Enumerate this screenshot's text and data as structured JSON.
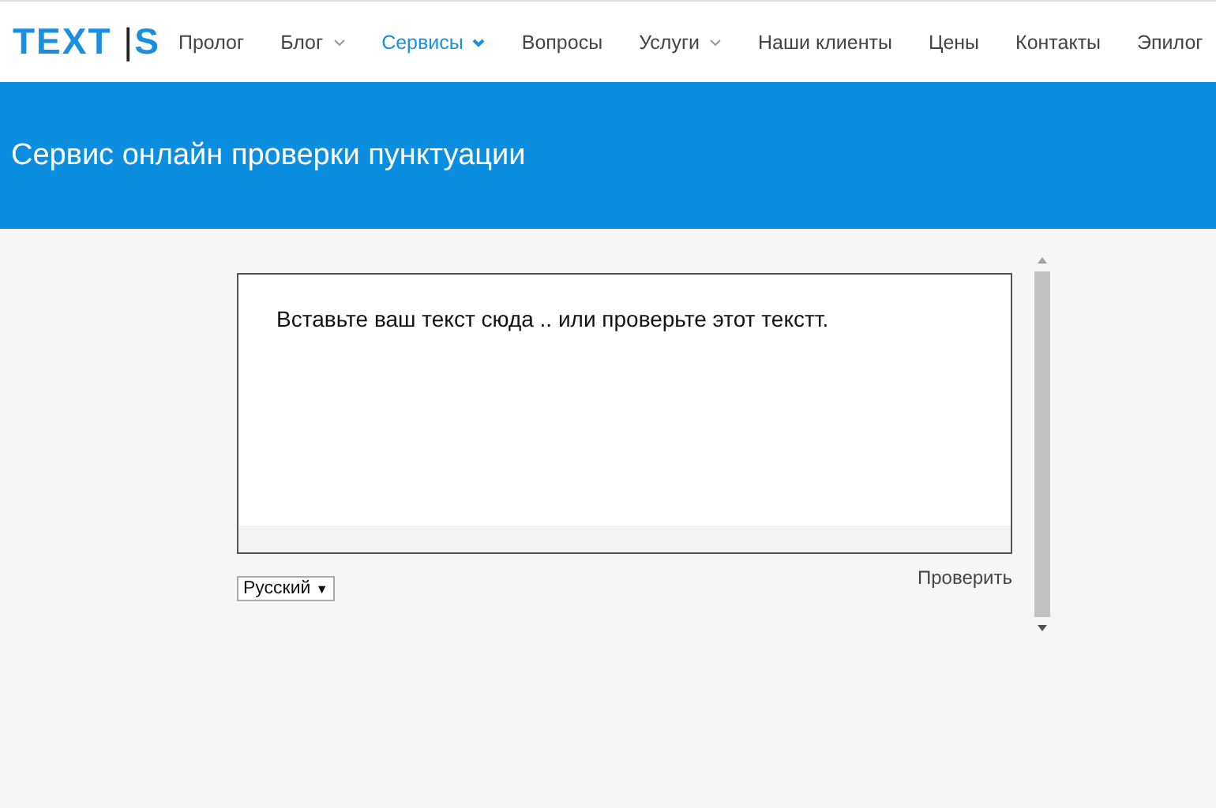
{
  "logo": {
    "text": "TEXT",
    "mark": "|",
    "suffix": "S"
  },
  "nav": [
    {
      "label": "Пролог",
      "selected": false,
      "dropdown": false
    },
    {
      "label": "Блог",
      "selected": false,
      "dropdown": true
    },
    {
      "label": "Сервисы",
      "selected": true,
      "dropdown": true
    },
    {
      "label": "Вопросы",
      "selected": false,
      "dropdown": false
    },
    {
      "label": "Услуги",
      "selected": false,
      "dropdown": true
    },
    {
      "label": "Наши клиенты",
      "selected": false,
      "dropdown": false
    },
    {
      "label": "Цены",
      "selected": false,
      "dropdown": false
    },
    {
      "label": "Контакты",
      "selected": false,
      "dropdown": false
    },
    {
      "label": "Эпилог",
      "selected": false,
      "dropdown": false
    }
  ],
  "banner": {
    "title": "Сервис онлайн проверки пунктуации"
  },
  "editor": {
    "value": "Вставьте ваш текст сюда .. или проверьте этот текстт."
  },
  "language_select": {
    "value": "Русский",
    "arrow": "▼"
  },
  "check_link": "Проверить"
}
